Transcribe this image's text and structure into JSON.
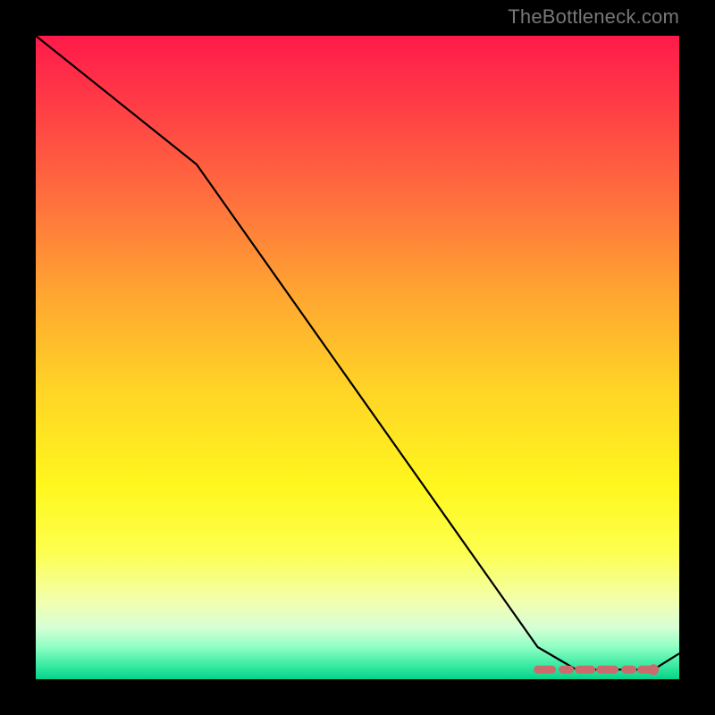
{
  "attribution": "TheBottleneck.com",
  "chart_data": {
    "type": "line",
    "title": "",
    "xlabel": "",
    "ylabel": "",
    "xlim": [
      0,
      100
    ],
    "ylim": [
      0,
      100
    ],
    "background_gradient": [
      "#ff1a4b",
      "#ffa531",
      "#fff71e",
      "#06d28a"
    ],
    "series": [
      {
        "name": "bottleneck-curve",
        "x": [
          0,
          25,
          78,
          84,
          92,
          96,
          100
        ],
        "values": [
          100,
          80,
          5,
          1.5,
          1.5,
          1.5,
          4
        ]
      }
    ],
    "highlight": {
      "name": "optimal-range",
      "x_start": 78,
      "x_end": 96,
      "y": 1.5
    },
    "marker": {
      "x": 96,
      "y": 1.5
    }
  }
}
